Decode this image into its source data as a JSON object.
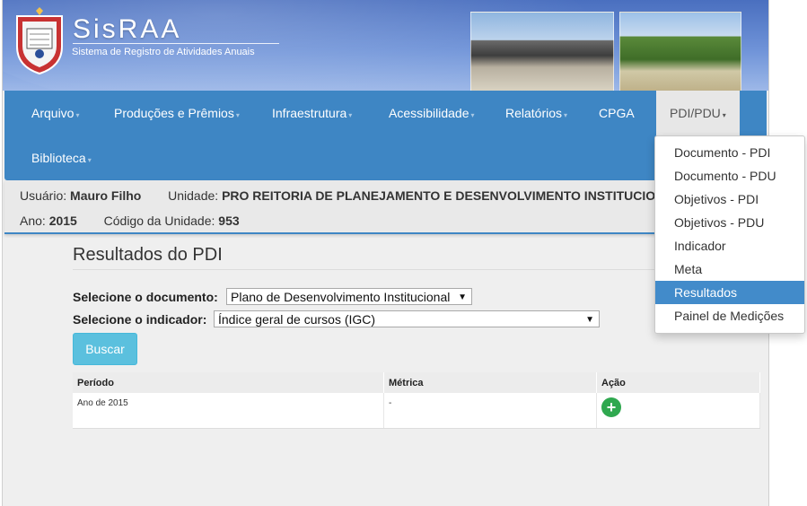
{
  "header": {
    "app_name": "SisRAA",
    "app_subtitle": "Sistema de Registro de Atividades Anuais"
  },
  "nav": {
    "items": [
      {
        "label": "Arquivo"
      },
      {
        "label": "Produções e Prêmios"
      },
      {
        "label": "Infraestrutura"
      },
      {
        "label": "Acessibilidade"
      },
      {
        "label": "Relatórios"
      },
      {
        "label": "CPGA"
      },
      {
        "label": "PDI/PDU"
      },
      {
        "label": "Biblioteca"
      }
    ],
    "caret": "▾"
  },
  "dropdown": {
    "items": [
      "Documento - PDI",
      "Documento - PDU",
      "Objetivos - PDI",
      "Objetivos - PDU",
      "Indicador",
      "Meta",
      "Resultados",
      "Painel de Medições"
    ],
    "selected": "Resultados"
  },
  "userbar": {
    "user_label": "Usuário:",
    "user_name": "Mauro Filho",
    "unit_label": "Unidade:",
    "unit_name": "PRO REITORIA DE PLANEJAMENTO E DESENVOLVIMENTO INSTITUCIO",
    "year_label": "Ano:",
    "year_value": "2015",
    "code_label": "Código da Unidade:",
    "code_value": "953"
  },
  "main": {
    "title": "Resultados do PDI",
    "document_label": "Selecione o documento:",
    "document_value": "Plano de Desenvolvimento Institucional",
    "indicator_label": "Selecione o indicador:",
    "indicator_value": "Índice geral de cursos (IGC)",
    "search_button": "Buscar",
    "table": {
      "headers": [
        "Período",
        "Métrica",
        "Ação"
      ],
      "rows": [
        {
          "periodo": "Ano de 2015",
          "metrica": "-",
          "acao_icon": "add-icon"
        }
      ]
    }
  },
  "colors": {
    "navbar": "#3e86c4",
    "dropdown_selected": "#428bca",
    "button": "#5bc0de",
    "add_icon": "#2fa84f"
  }
}
